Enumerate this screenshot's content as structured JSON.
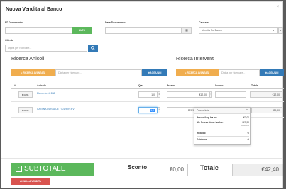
{
  "modal": {
    "title": "Nuova Vendita al Banco",
    "close": "×"
  },
  "header": {
    "doc_number_label": "N° Documento",
    "auto_button": "AUTO",
    "doc_date_label": "Data Documento",
    "causale_label": "Causale",
    "causale_value": "Vendita Da Banco",
    "client_label": "Cliente",
    "client_placeholder": "Digita per ricercare..."
  },
  "articles": {
    "title": "Ricerca Articoli",
    "advanced_search": "RICERCA AVANZATA",
    "search_placeholder": "Digita per ricercare...",
    "add_button": "✚AGGIUNGI",
    "columns": [
      "#",
      "Articolo",
      "Qta",
      "Prezzo",
      "Sconto",
      "Totale"
    ],
    "rows": [
      {
        "cancel": "✖canc.",
        "name": "Elemento N. 288",
        "qty": "1,0",
        "price": "€12,00",
        "discount": "",
        "total": "€12,00"
      },
      {
        "cancel": "✖canc.",
        "name": "CATENA DURAACE 7701 9TR 8 V",
        "qty": "1,0",
        "price": "€29,90",
        "discount": "",
        "total": "€29,90"
      }
    ]
  },
  "interventions": {
    "title": "Ricerca Interventi",
    "advanced_search": "RICERCA AVANZATA",
    "search_placeholder": "Digita per ricercare...",
    "add_button": "✚AGGIUNGI"
  },
  "price_info": {
    "title": "Prezzo Info",
    "close": "×",
    "rows": [
      {
        "label": "Prezzo Acq. Iva Inc.",
        "value": "€0,00"
      },
      {
        "label": "Ult. Prezzo Vend. Iva Inc.",
        "value": "€29,90"
      },
      {
        "label": "",
        "value": "12/04/2015"
      },
      {
        "label": "Ricarico",
        "value": "%"
      },
      {
        "label": "Esistenza",
        "value": "-1"
      }
    ]
  },
  "footer": {
    "subtotal_button": "SUBTOTALE",
    "cancel_sale_button": "ANNULLA VENDITA",
    "discount_label": "Sconto",
    "discount_value": "€0,00",
    "total_label": "Totale",
    "total_value": "€42,40"
  },
  "colors": {
    "primary": "#337ab7",
    "success": "#5cb85c",
    "warning": "#f0ad4e",
    "danger": "#d9534f"
  }
}
